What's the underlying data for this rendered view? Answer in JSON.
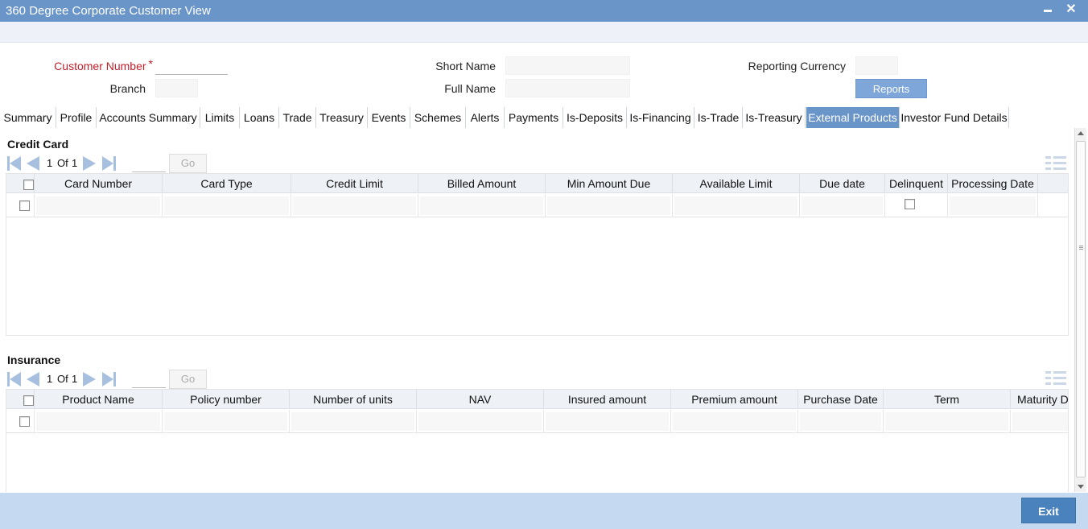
{
  "window": {
    "title": "360 Degree Corporate Customer View"
  },
  "header": {
    "customer_number_label": "Customer Number",
    "required_mark": "*",
    "customer_number_value": "",
    "branch_label": "Branch",
    "branch_value": "",
    "short_name_label": "Short Name",
    "short_name_value": "",
    "full_name_label": "Full Name",
    "full_name_value": "",
    "reporting_currency_label": "Reporting Currency",
    "reporting_currency_value": "",
    "reports_button": "Reports"
  },
  "tabs": [
    "Summary",
    "Profile",
    "Accounts Summary",
    "Limits",
    "Loans",
    "Trade",
    "Treasury",
    "Events",
    "Schemes",
    "Alerts",
    "Payments",
    "Is-Deposits",
    "Is-Financing",
    "Is-Trade",
    "Is-Treasury",
    "External Products",
    "Investor Fund Details"
  ],
  "active_tab": "External Products",
  "credit_card": {
    "title": "Credit Card",
    "pager": {
      "current": "1",
      "of_label": "Of",
      "total": "1",
      "go_label": "Go"
    },
    "columns": [
      "Card Number",
      "Card Type",
      "Credit Limit",
      "Billed Amount",
      "Min Amount Due",
      "Available Limit",
      "Due date",
      "Delinquent",
      "Processing Date"
    ]
  },
  "insurance": {
    "title": "Insurance",
    "pager": {
      "current": "1",
      "of_label": "Of",
      "total": "1",
      "go_label": "Go"
    },
    "columns": [
      "Product Name",
      "Policy number",
      "Number of units",
      "NAV",
      "Insured amount",
      "Premium amount",
      "Purchase Date",
      "Term",
      "Maturity Da"
    ]
  },
  "footer": {
    "exit_button": "Exit"
  },
  "colors": {
    "accent": "#6a95c8",
    "footer": "#c5daf0",
    "exit": "#4a82bd",
    "required": "#c0202a"
  }
}
